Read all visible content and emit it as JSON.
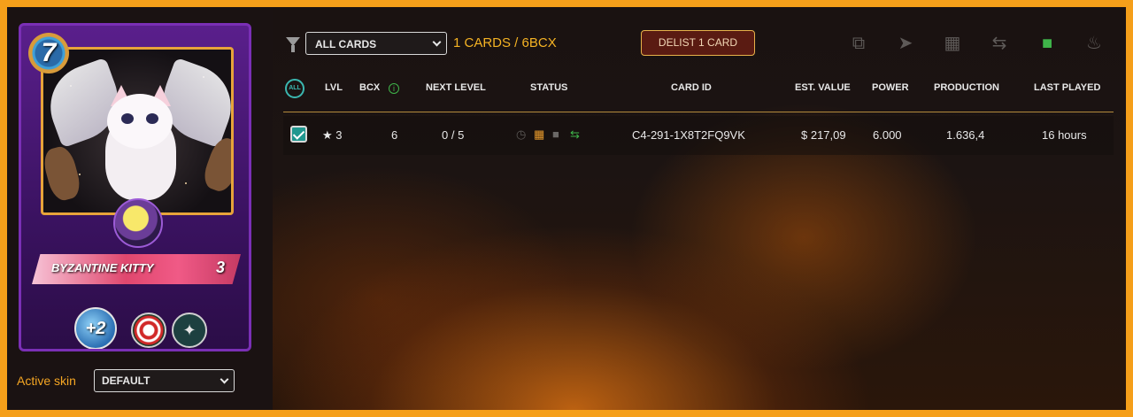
{
  "card": {
    "level": "7",
    "name": "BYZANTINE KITTY",
    "card_level": "3",
    "ability_bonus": "+2"
  },
  "skin": {
    "label": "Active skin",
    "selected": "DEFAULT"
  },
  "toolbar": {
    "filter_selected": "ALL CARDS",
    "count_text": "1 CARDS / 6BCX",
    "delist_label": "DELIST 1 CARD",
    "icons": [
      "combine-icon",
      "send-icon",
      "market-icon",
      "transfer-icon",
      "lock-icon",
      "burn-icon"
    ]
  },
  "table": {
    "all_label": "ALL",
    "headers": {
      "lvl": "LVL",
      "bcx": "BCX",
      "next_level": "NEXT LEVEL",
      "status": "STATUS",
      "card_id": "CARD ID",
      "est_value": "EST. VALUE",
      "power": "POWER",
      "production": "PRODUCTION",
      "last_played": "LAST PLAYED"
    },
    "rows": [
      {
        "lvl": "★ 3",
        "bcx": "6",
        "next_level": "0 / 5",
        "card_id": "C4-291-1X8T2FQ9VK",
        "est_value": "$ 217,09",
        "power": "6.000",
        "production": "1.636,4",
        "last_played": "16 hours",
        "checked": true
      }
    ]
  },
  "colors": {
    "accent": "#f5a623",
    "checkbox": "#20978f",
    "lock_green": "#3fb44a",
    "delist_bg": "#5a1b12"
  }
}
